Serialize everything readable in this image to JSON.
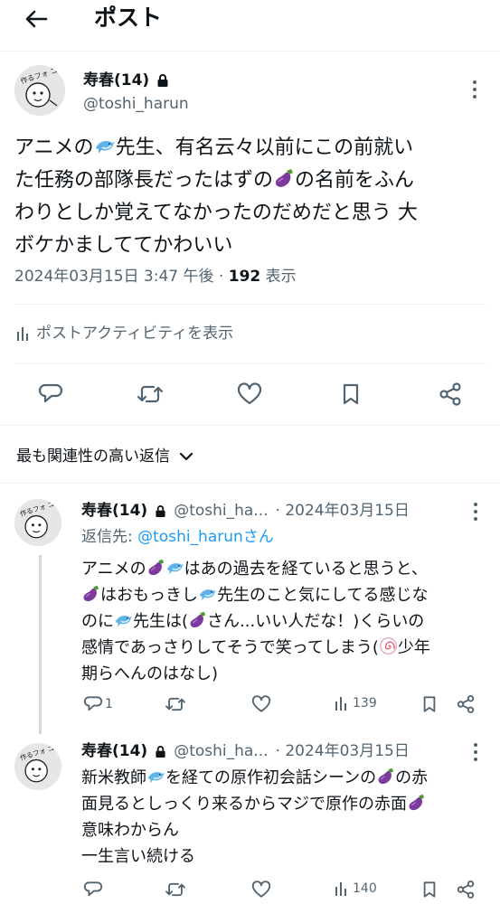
{
  "header": {
    "title": "ポスト"
  },
  "main_post": {
    "name": "寿春(14)",
    "handle": "@toshi_harun",
    "avatar_text": "作るフォ ゴロンか",
    "lines": [
      [
        "アニメの",
        "DOLPHIN",
        "先生、有名云々以前にこの前就い"
      ],
      [
        "た任務の部隊長だったはずの",
        "EGGPLANT",
        "の名前をふん"
      ],
      [
        "わりとしか覚えてなかったのだめだと思う 大"
      ],
      [
        "ボケかましててかわいい"
      ]
    ],
    "date": "2024年03月15日 3:47 午後",
    "separator": "·",
    "views_count": "192",
    "views_label": "表示",
    "activity_label": "ポストアクティビティを表示"
  },
  "sort": {
    "label": "最も関連性の高い返信"
  },
  "replies": [
    {
      "name": "寿春(14)",
      "handle": "@toshi_ha...",
      "date": "· 2024年03月15日",
      "reply_to_prefix": "返信先: ",
      "reply_to_handle": "@toshi_harunさん",
      "lines": [
        [
          "アニメの",
          "EGGPLANT",
          "DOLPHIN",
          "はあの過去を経ていると思うと、"
        ],
        [
          "EGGPLANT",
          "はおもっきし",
          "DOLPHIN",
          "先生のこと気にしてる感じな"
        ],
        [
          "のに",
          "DOLPHIN",
          "先生は(",
          "EGGPLANT",
          "さん...いい人だな！)くらいの"
        ],
        [
          "感情であっさりしてそうで笑ってしまう(",
          "NARUTO",
          "少年"
        ],
        [
          "期らへんのはなし)"
        ]
      ],
      "reply_count": "1",
      "views": "139"
    },
    {
      "name": "寿春(14)",
      "handle": "@toshi_ha...",
      "date": "· 2024年03月15日",
      "lines": [
        [
          "新米教師",
          "DOLPHIN",
          "を経ての原作初会話シーンの",
          "EGGPLANT",
          "の赤"
        ],
        [
          "面見るとしっくり来るからマジで原作の赤面",
          "EGGPLANT"
        ],
        [
          "意味わからん"
        ],
        [
          "一生言い続ける"
        ]
      ],
      "reply_count": "",
      "views": "140"
    }
  ],
  "colors": {
    "accent": "#1d9bf0",
    "muted": "#536471",
    "text": "#0f1419",
    "divider": "#eff3f4"
  }
}
